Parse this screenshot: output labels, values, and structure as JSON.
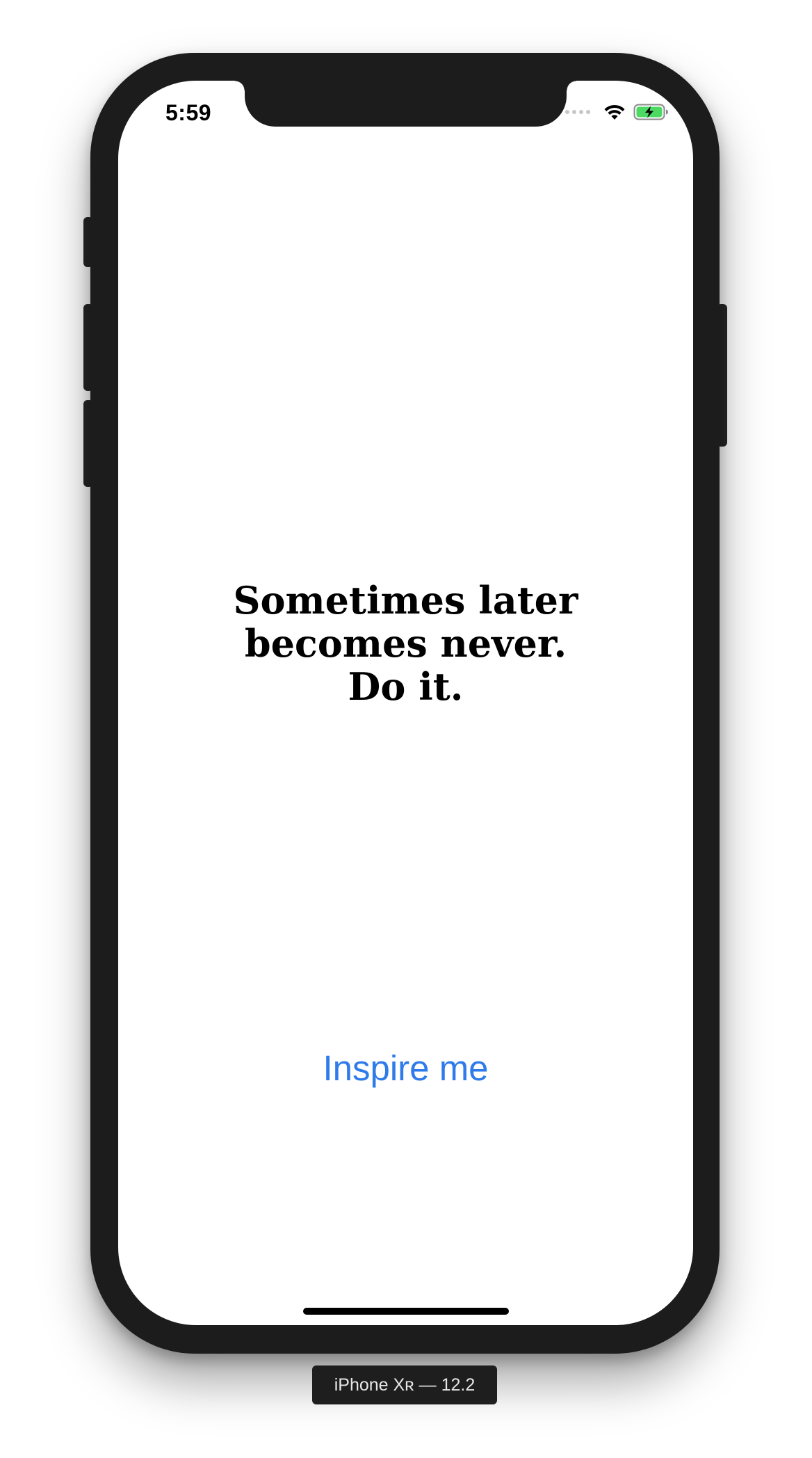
{
  "status_bar": {
    "time": "5:59",
    "icons": [
      "signal-dots-icon",
      "wifi-icon",
      "battery-charging-icon"
    ],
    "battery_color": "#4cd964"
  },
  "quote": {
    "lines": [
      "Sometimes later",
      "becomes never.",
      "Do it."
    ]
  },
  "action_button": {
    "label": "Inspire me",
    "color": "#2f7bea"
  },
  "simulator_label": "iPhone Xʀ — 12.2"
}
